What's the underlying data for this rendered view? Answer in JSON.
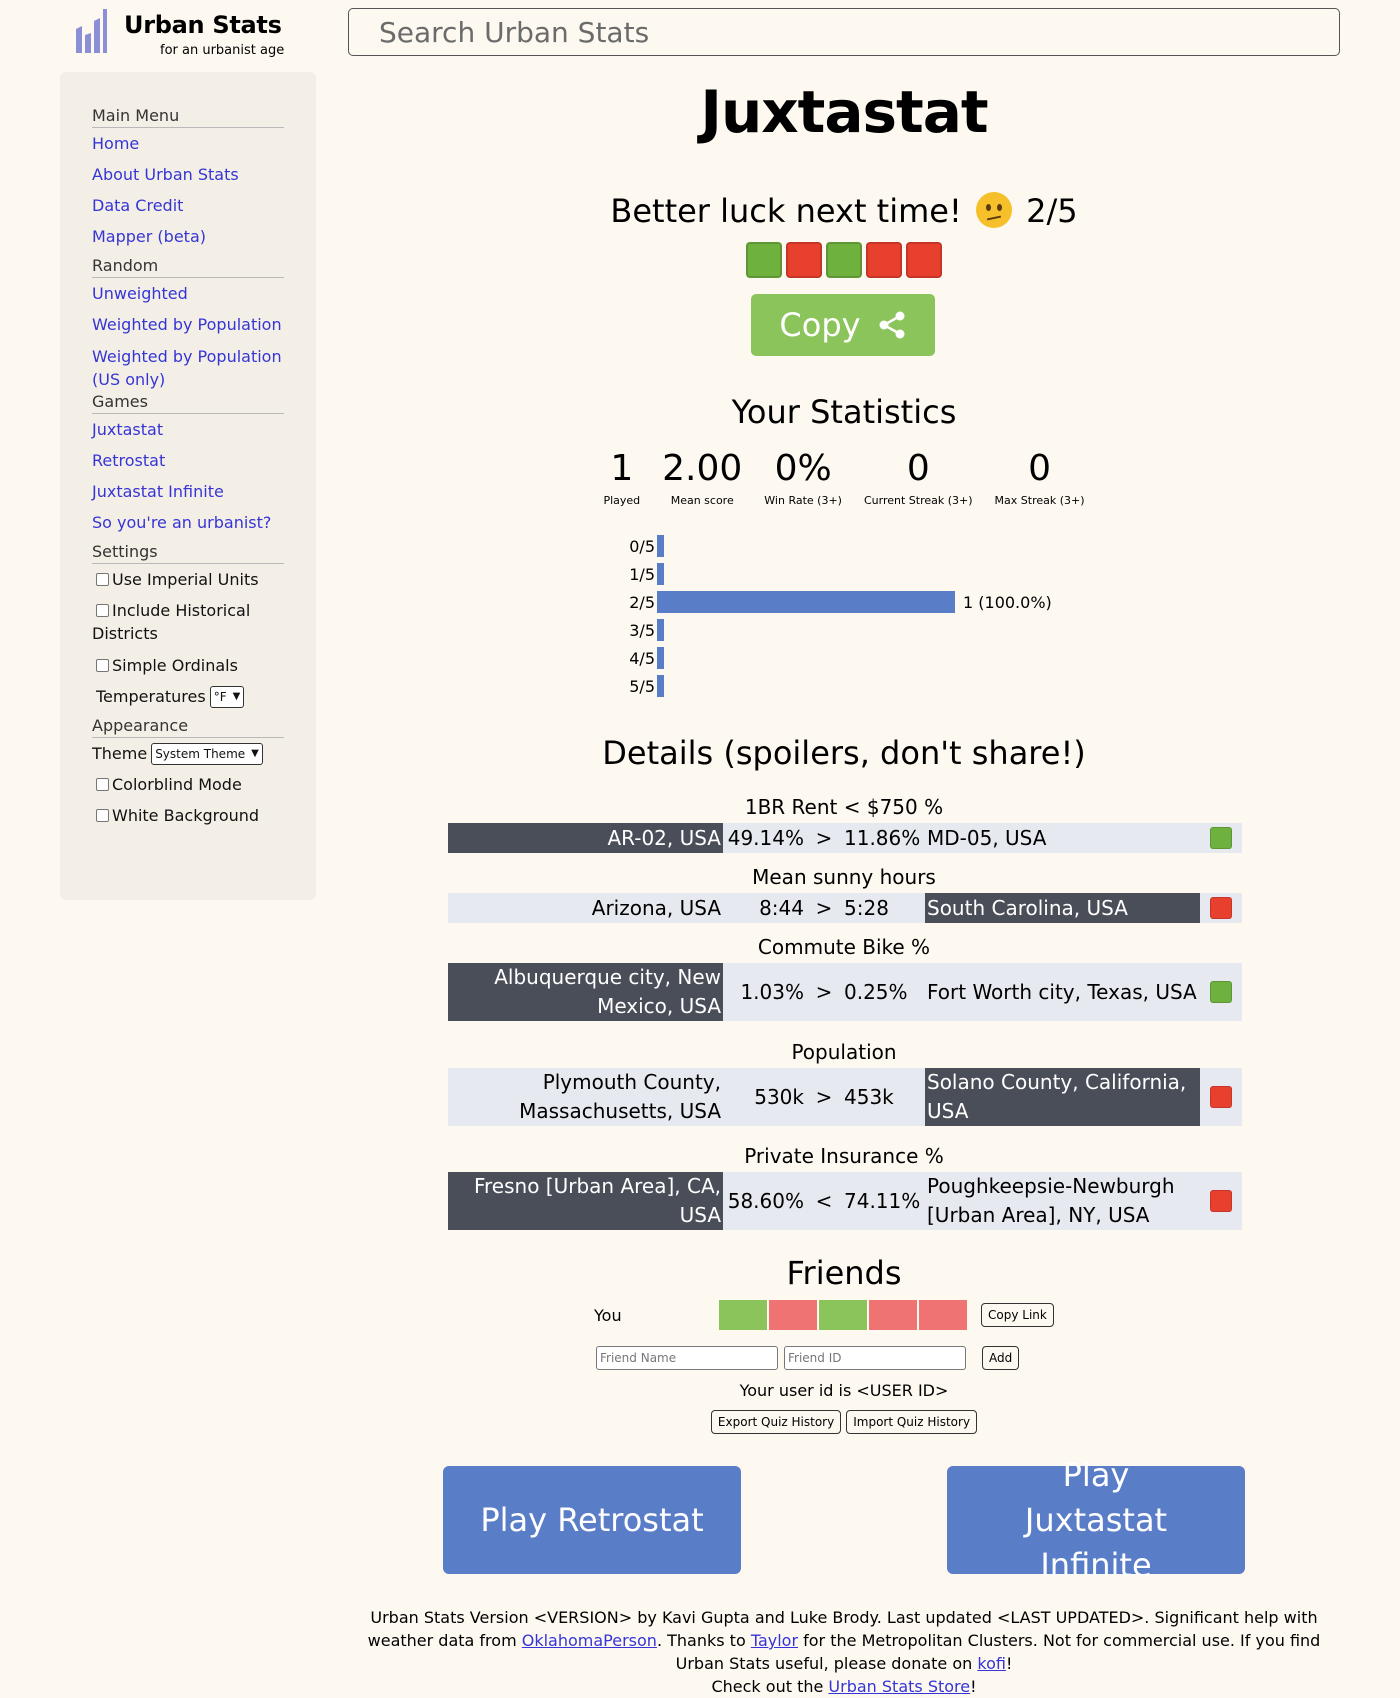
{
  "header": {
    "logo_title": "Urban Stats",
    "logo_subtitle": "for an urbanist age",
    "search_placeholder": "Search Urban Stats"
  },
  "sidebar": {
    "main_menu": {
      "heading": "Main Menu",
      "items": [
        "Home",
        "About Urban Stats",
        "Data Credit",
        "Mapper (beta)"
      ]
    },
    "random": {
      "heading": "Random",
      "items": [
        "Unweighted",
        "Weighted by Population",
        "Weighted by Population (US only)"
      ]
    },
    "games": {
      "heading": "Games",
      "items": [
        "Juxtastat",
        "Retrostat",
        "Juxtastat Infinite",
        "So you're an urbanist?"
      ]
    },
    "settings": {
      "heading": "Settings",
      "use_imperial": "Use Imperial Units",
      "include_historical": "Include Historical Districts",
      "simple_ordinals": "Simple Ordinals",
      "temperatures_label": "Temperatures",
      "temperature_value": "°F"
    },
    "appearance": {
      "heading": "Appearance",
      "theme_label": "Theme",
      "theme_value": "System Theme",
      "colorblind": "Colorblind Mode",
      "white_background": "White Background"
    }
  },
  "game": {
    "title": "Juxtastat",
    "result_text": "Better luck next time!",
    "result_score": "2/5",
    "result_emoji": "confused-face",
    "result_squares": [
      "correct",
      "wrong",
      "correct",
      "wrong",
      "wrong"
    ],
    "copy_label": "Copy",
    "colors": {
      "correct": "#6fb13f",
      "wrong": "#e8402f",
      "accent": "#5a7dc8",
      "copy": "#8bc45b"
    }
  },
  "statistics": {
    "heading": "Your Statistics",
    "items": [
      {
        "value": "1",
        "label": "Played"
      },
      {
        "value": "2.00",
        "label": "Mean score"
      },
      {
        "value": "0%",
        "label": "Win Rate (3+)"
      },
      {
        "value": "0",
        "label": "Current Streak (3+)"
      },
      {
        "value": "0",
        "label": "Max Streak (3+)"
      }
    ],
    "distribution": [
      {
        "label": "0/5",
        "fraction": 0,
        "count": ""
      },
      {
        "label": "1/5",
        "fraction": 0,
        "count": ""
      },
      {
        "label": "2/5",
        "fraction": 1.0,
        "count": "1 (100.0%)"
      },
      {
        "label": "3/5",
        "fraction": 0,
        "count": ""
      },
      {
        "label": "4/5",
        "fraction": 0,
        "count": ""
      },
      {
        "label": "5/5",
        "fraction": 0,
        "count": ""
      }
    ]
  },
  "details": {
    "heading": "Details (spoilers, don't share!)",
    "questions": [
      {
        "stat": "1BR Rent < $750 %",
        "left": "AR-02, USA",
        "left_value": "49.14%",
        "op": ">",
        "right_value": "11.86%",
        "right": "MD-05, USA",
        "chosen": "left",
        "result": "correct"
      },
      {
        "stat": "Mean sunny hours",
        "left": "Arizona, USA",
        "left_value": "8:44",
        "op": ">",
        "right_value": "5:28",
        "right": "South Carolina, USA",
        "chosen": "right",
        "result": "wrong"
      },
      {
        "stat": "Commute Bike %",
        "left": "Albuquerque city, New Mexico, USA",
        "left_value": "1.03%",
        "op": ">",
        "right_value": "0.25%",
        "right": "Fort Worth city, Texas, USA",
        "chosen": "left",
        "result": "correct"
      },
      {
        "stat": "Population",
        "left": "Plymouth County, Massachusetts, USA",
        "left_value": "530k",
        "op": ">",
        "right_value": "453k",
        "right": "Solano County, California, USA",
        "chosen": "right",
        "result": "wrong"
      },
      {
        "stat": "Private Insurance %",
        "left": "Fresno [Urban Area], CA, USA",
        "left_value": "58.60%",
        "op": "<",
        "right_value": "74.11%",
        "right": "Poughkeepsie-Newburgh [Urban Area], NY, USA",
        "chosen": "left",
        "result": "wrong"
      }
    ]
  },
  "friends": {
    "heading": "Friends",
    "you_label": "You",
    "copy_link": "Copy Link",
    "friend_name_placeholder": "Friend Name",
    "friend_id_placeholder": "Friend ID",
    "add_label": "Add",
    "user_id_text": "Your user id is <USER ID>",
    "export_label": "Export Quiz History",
    "import_label": "Import Quiz History"
  },
  "actions": {
    "play_retrostat": "Play Retrostat",
    "play_infinite": "Play Juxtastat Infinite"
  },
  "footer": {
    "text1": "Urban Stats Version <VERSION> by Kavi Gupta and Luke Brody. Last updated <LAST UPDATED>. Significant help with weather data from ",
    "link1": "OklahomaPerson",
    "text2": ". Thanks to ",
    "link2": "Taylor",
    "text3": " for the Metropolitan Clusters. Not for commercial use. If you find Urban Stats useful, please donate on ",
    "link3": "kofi",
    "text4": "!",
    "text5": "Check out the ",
    "link4": "Urban Stats Store",
    "text6": "!"
  }
}
